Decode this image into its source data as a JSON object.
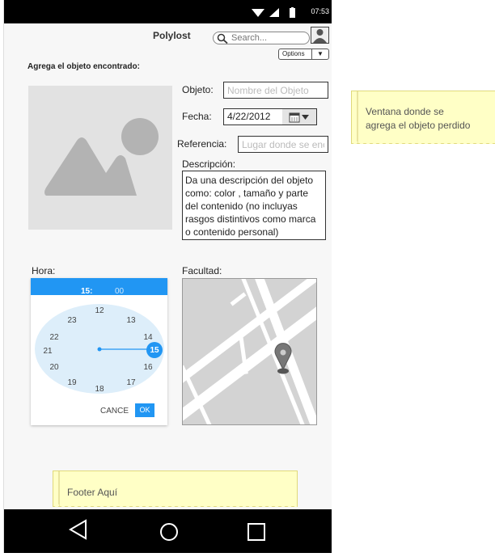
{
  "status_bar": {
    "time": "07:53"
  },
  "header": {
    "title": "Polylost",
    "search_placeholder": "Search...",
    "options_label": "Options"
  },
  "form": {
    "heading": "Agrega el objeto encontrado:",
    "object_label": "Objeto:",
    "object_placeholder": "Nombre del Objeto",
    "date_label": "Fecha:",
    "date_value": "4/22/2012",
    "reference_label": "Referencia:",
    "reference_placeholder": "Lugar donde se enco",
    "description_label": "Descripción:",
    "description_lines": [
      "Da una descripción del objeto",
      "como: color , tamaño y parte",
      "del contenido (no incluyas",
      "rasgos distintivos como marca",
      "o contenido personal)"
    ]
  },
  "time_picker": {
    "label": "Hora:",
    "hour": "15:",
    "minute": "00",
    "numbers": [
      "12",
      "13",
      "14",
      "15",
      "16",
      "17",
      "18",
      "19",
      "20",
      "21",
      "22",
      "23"
    ],
    "selected": "15",
    "cancel_label": "CANCE",
    "ok_label": "OK"
  },
  "map": {
    "label": "Facultad:"
  },
  "notes": {
    "window_note_lines": [
      "Ventana donde se",
      "agrega el objeto perdido"
    ],
    "footer_note": "Footer Aquí"
  },
  "colors": {
    "accent": "#2196f3",
    "note": "#ffffc6",
    "statusbar": "#000000"
  }
}
